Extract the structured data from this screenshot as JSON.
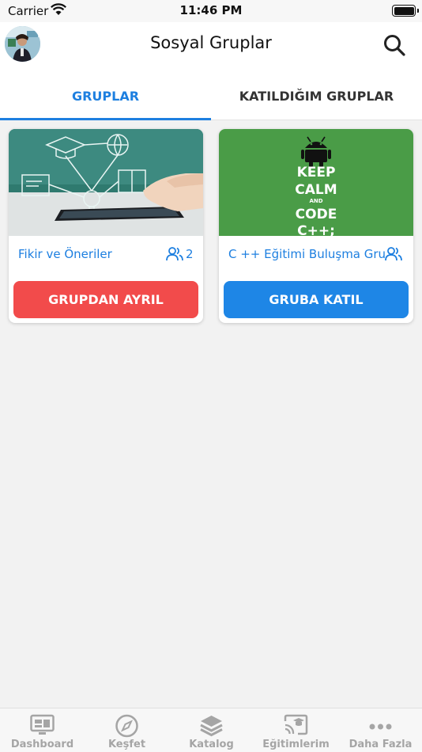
{
  "status_bar": {
    "carrier": "Carrier",
    "time": "11:46 PM"
  },
  "nav": {
    "title": "Sosyal Gruplar",
    "search_icon": "search-icon",
    "avatar_icon": "user-avatar"
  },
  "tabs": [
    {
      "label": "GRUPLAR",
      "active": true
    },
    {
      "label": "KATILDIĞIM GRUPLAR",
      "active": false
    }
  ],
  "groups": [
    {
      "title": "Fikir ve Öneriler",
      "member_count": "2",
      "button_label": "GRUPDAN AYRIL",
      "button_color": "#f24b4b",
      "image": "idea-network-illustration"
    },
    {
      "title": "C ++ Eğitimi Buluşma Grubu",
      "member_count": "",
      "button_label": "GRUBA KATIL",
      "button_color": "#1e86e6",
      "image": "keep-calm-code-poster",
      "image_text": [
        "KEEP",
        "CALM",
        "AND",
        "CODE",
        "C++;"
      ]
    }
  ],
  "tab_bar": [
    {
      "label": "Dashboard",
      "icon": "monitor-icon"
    },
    {
      "label": "Keşfet",
      "icon": "compass-icon"
    },
    {
      "label": "Katalog",
      "icon": "layers-icon"
    },
    {
      "label": "Eğitimlerim",
      "icon": "cast-icon"
    },
    {
      "label": "Daha Fazla",
      "icon": "more-icon"
    }
  ],
  "colors": {
    "accent": "#1d7fe0",
    "danger": "#f24b4b",
    "primary_button": "#1e86e6",
    "poster_green": "#4a9c47",
    "inactive": "#a5a5a5"
  }
}
